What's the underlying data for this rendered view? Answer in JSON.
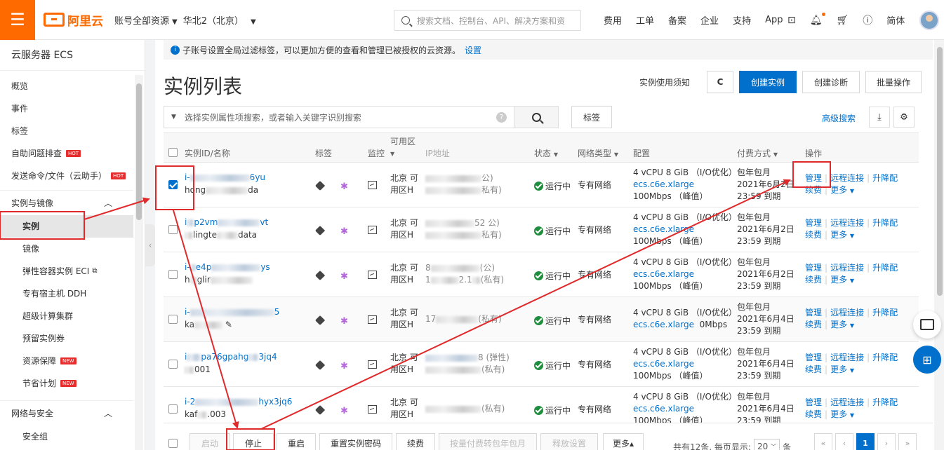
{
  "topbar": {
    "brand": "阿里云",
    "account_scope": "账号全部资源",
    "region": "华北2（北京）",
    "search_placeholder": "搜索文档、控制台、API、解决方案和资",
    "links": [
      "费用",
      "工单",
      "备案",
      "企业",
      "支持",
      "App"
    ],
    "lang": "简体"
  },
  "sidebar": {
    "title": "云服务器 ECS",
    "top_items": [
      {
        "label": "概览"
      },
      {
        "label": "事件"
      },
      {
        "label": "标签"
      },
      {
        "label": "自助问题排查",
        "badge": "HOT"
      },
      {
        "label": "发送命令/文件（云助手）",
        "badge": "HOT"
      }
    ],
    "group1": "实例与镜像",
    "group1_items": [
      {
        "label": "实例"
      },
      {
        "label": "镜像"
      },
      {
        "label": "弹性容器实例 ECI"
      },
      {
        "label": "专有宿主机 DDH"
      },
      {
        "label": "超级计算集群"
      },
      {
        "label": "预留实例券"
      },
      {
        "label": "资源保障",
        "badge": "NEW"
      },
      {
        "label": "节省计划",
        "badge": "NEW"
      }
    ],
    "group2": "网络与安全",
    "group2_items": [
      {
        "label": "安全组"
      }
    ]
  },
  "notice": {
    "text": "子账号设置全局过滤标签，可以更加方便的查看和管理已被授权的云资源。",
    "link": "设置"
  },
  "page": {
    "title": "实例列表",
    "usage_note": "实例使用须知",
    "refresh_icon": "C",
    "create_btn": "创建实例",
    "diagnose_btn": "创建诊断",
    "batch_btn": "批量操作",
    "filter_placeholder": "选择实例属性项搜索，或者输入关键字识别搜索",
    "tag_btn": "标签",
    "advanced_search": "高级搜索"
  },
  "table": {
    "headers": {
      "id": "实例ID/名称",
      "tag": "标签",
      "monitor": "监控",
      "zone": "可用区",
      "ip": "IP地址",
      "status": "状态",
      "network": "网络类型",
      "config": "配置",
      "billing": "付费方式",
      "ops": "操作"
    },
    "rows": [
      {
        "id_tail": "6yu",
        "name_head": "hong",
        "name_tail": "da",
        "zone1": "北京 可",
        "zone2": "用区H",
        "ip1_tail": "公)",
        "ip2_tail": "私有)",
        "status": "运行中",
        "network": "专有网络",
        "cfg1": "4 vCPU 8 GiB （I/O优化）",
        "spec": "ecs.c6e.xlarge",
        "bw": "100Mbps （峰值）",
        "bill1": "包年包月",
        "bill2": "2021年6月2日",
        "bill3": "23:59 到期",
        "checked": true
      },
      {
        "id_head": "i",
        "id_mid": "p2vm",
        "id_tail": "vt",
        "name_head": "",
        "name_mid": "lingte",
        "name_tail": "data",
        "zone1": "北京 可",
        "zone2": "用区H",
        "ip1_tail": "52  公)",
        "ip2_tail": "私有)",
        "status": "运行中",
        "network": "专有网络",
        "cfg1": "4 vCPU 8 GiB （I/O优化）",
        "spec": "ecs.c6e.xlarge",
        "bw": "100Mbps （峰值）",
        "bill1": "包年包月",
        "bill2": "2021年6月2日",
        "bill3": "23:59 到期",
        "checked": false
      },
      {
        "id_head": "i-",
        "id_mid": "e4p",
        "id_tail": "ys",
        "name_head": "h",
        "name_mid": "glir",
        "name_tail": "",
        "zone1": "北京 可",
        "zone2": "用区H",
        "ip1_head": "8",
        "ip1_tail": "(公)",
        "ip2_head": "1",
        "ip2_mid": "2.1",
        "ip2_tail": "(私有)",
        "status": "运行中",
        "network": "专有网络",
        "cfg1": "4 vCPU 8 GiB （I/O优化）",
        "spec": "ecs.c6e.xlarge",
        "bw": "100Mbps （峰值）",
        "bill1": "包年包月",
        "bill2": "2021年6月2日",
        "bill3": "23:59 到期",
        "checked": false
      },
      {
        "id_head": "i-",
        "id_tail": "5",
        "name_head": "ka",
        "zone1": "北京 可",
        "zone2": "用区H",
        "ip1_head": "17",
        "ip1_tail": "(私有)",
        "status": "运行中",
        "network": "专有网络",
        "cfg1": "4 vCPU 8 GiB （I/O优化）",
        "spec": "ecs.c6e.xlarge",
        "bw": "0Mbps",
        "bill1": "包年包月",
        "bill2": "2021年6月4日",
        "bill3": "23:59 到期",
        "checked": false
      },
      {
        "id_head": "i",
        "id_mid": "pa76gpahg",
        "id_tail": "3jq4",
        "name_tail": "001",
        "zone1": "北京 可",
        "zone2": "用区H",
        "ip1_tail": "8 (弹性)",
        "ip2_tail": "(私有)",
        "status": "运行中",
        "network": "专有网络",
        "cfg1": "4 vCPU 8 GiB （I/O优化）",
        "spec": "ecs.c6e.xlarge",
        "bw": "100Mbps （峰值）",
        "bill1": "包年包月",
        "bill2": "2021年6月4日",
        "bill3": "23:59 到期",
        "checked": false
      },
      {
        "id_head": "i-2",
        "id_tail": "hyx3jq6",
        "name_head": "kaf",
        "name_tail": ".003",
        "zone1": "北京 可",
        "zone2": "用区H",
        "ip1_tail": "(私有)",
        "status": "运行中",
        "network": "专有网络",
        "cfg1": "4 vCPU 8 GiB （I/O优化）",
        "spec": "ecs.c6e.xlarge",
        "bw": "100Mbps （峰值）",
        "bill1": "包年包月",
        "bill2": "2021年6月4日",
        "bill3": "23:59 到期",
        "checked": false
      }
    ],
    "ops": {
      "manage": "管理",
      "remote": "远程连接",
      "upgrade": "升降配",
      "renew": "续费",
      "more": "更多"
    }
  },
  "footer": {
    "buttons": [
      {
        "label": "启动",
        "disabled": true
      },
      {
        "label": "停止",
        "disabled": false
      },
      {
        "label": "重启",
        "disabled": false
      },
      {
        "label": "重置实例密码",
        "disabled": false
      },
      {
        "label": "续费",
        "disabled": false
      },
      {
        "label": "按量付费转包年包月",
        "disabled": true
      },
      {
        "label": "释放设置",
        "disabled": true
      },
      {
        "label": "更多▴",
        "disabled": false
      }
    ],
    "total_text": "共有12条, 每页显示:",
    "page_size": "20",
    "unit": "条",
    "pager": [
      "«",
      "‹",
      "1",
      "›",
      "»"
    ]
  },
  "colors": {
    "accent": "#0070cc",
    "brand": "#ff6a00",
    "annotation": "#e0292b",
    "running": "#1e8e3e"
  }
}
